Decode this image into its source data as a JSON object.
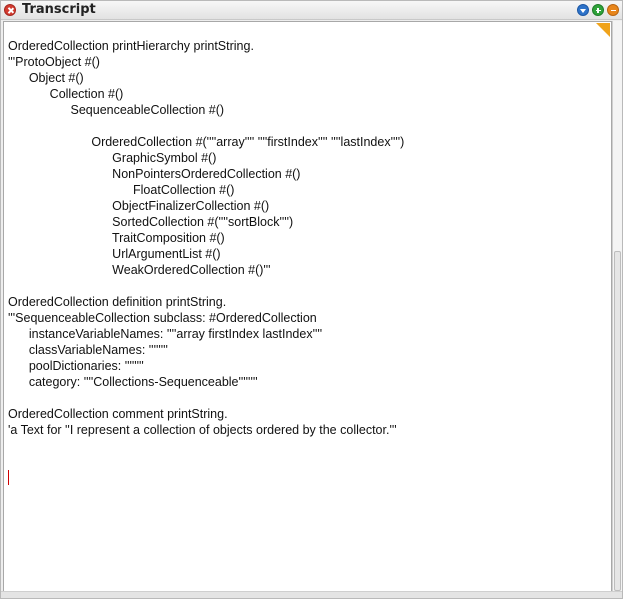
{
  "window": {
    "title": "Transcript"
  },
  "icons": {
    "close": "close-icon",
    "menu": "menu-icon",
    "expand": "expand-icon",
    "collapse": "collapse-icon"
  },
  "colors": {
    "close": "#d33a2f",
    "menu": "#2e73c9",
    "expand": "#2fa23a",
    "collapse": "#e8861b",
    "cursor": "#d00000",
    "corner": "#f0a31b"
  },
  "transcript": {
    "lines": [
      "OrderedCollection printHierarchy printString.",
      "'''ProtoObject #()",
      "      Object #()",
      "            Collection #()",
      "                  SequenceableCollection #()",
      "",
      "                        OrderedCollection #(''''array'''' ''''firstIndex'''' ''''lastIndex'''')",
      "                              GraphicSymbol #()",
      "                              NonPointersOrderedCollection #()",
      "                                    FloatCollection #()",
      "                              ObjectFinalizerCollection #()",
      "                              SortedCollection #(''''sortBlock'''')",
      "                              TraitComposition #()",
      "                              UrlArgumentList #()",
      "                              WeakOrderedCollection #()'''",
      "",
      "OrderedCollection definition printString.",
      "'''SequenceableCollection subclass: #OrderedCollection",
      "      instanceVariableNames: ''''array firstIndex lastIndex''''",
      "      classVariableNames: ''''''''",
      "      poolDictionaries: ''''''''",
      "      category: ''''Collections-Sequenceable''''''''",
      "",
      "OrderedCollection comment printString.",
      "'a Text for ''I represent a collection of objects ordered by the collector.'''"
    ]
  }
}
